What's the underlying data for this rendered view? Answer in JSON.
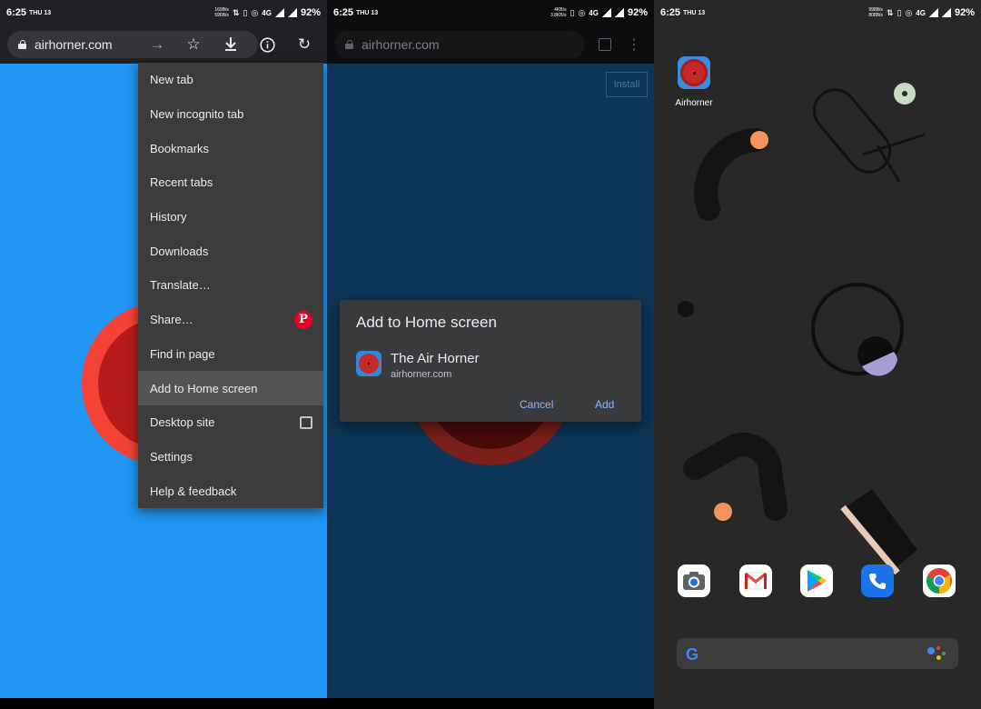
{
  "status_panel1": {
    "time": "6:25",
    "day": "THU 13",
    "speed_up": "169B/s",
    "speed_down": "596B/s",
    "network": "4G",
    "battery": "92%"
  },
  "status_panel2": {
    "time": "6:25",
    "day": "THU 13",
    "speed_up": "4KB/s",
    "speed_down": "3.8KB/s",
    "network": "4G",
    "battery": "92%"
  },
  "status_panel3": {
    "time": "6:25",
    "day": "THU 13",
    "speed_up": "998B/s",
    "speed_down": "808B/s",
    "network": "4G",
    "battery": "92%"
  },
  "browser": {
    "url": "airhorner.com"
  },
  "menu": {
    "items": [
      "New tab",
      "New incognito tab",
      "Bookmarks",
      "Recent tabs",
      "History",
      "Downloads",
      "Translate…",
      "Share…",
      "Find in page",
      "Add to Home screen",
      "Desktop site",
      "Settings",
      "Help & feedback"
    ],
    "highlighted": "Add to Home screen",
    "desktop_site_checked": false
  },
  "install_button": "Install",
  "dialog": {
    "title": "Add to Home screen",
    "app_name": "The Air Horner",
    "app_url": "airhorner.com",
    "cancel": "Cancel",
    "add": "Add"
  },
  "home": {
    "app_label": "Airhorner",
    "dock": [
      "camera-icon",
      "gmail-icon",
      "play-store-icon",
      "phone-icon",
      "chrome-icon"
    ],
    "search_logo": "G"
  },
  "colors": {
    "panel1_bg": "#2196f3",
    "panel2_bg": "#0c3557",
    "panel3_bg": "#282828",
    "accent_link": "#8ab4f8",
    "horn_red": "#c62828"
  }
}
